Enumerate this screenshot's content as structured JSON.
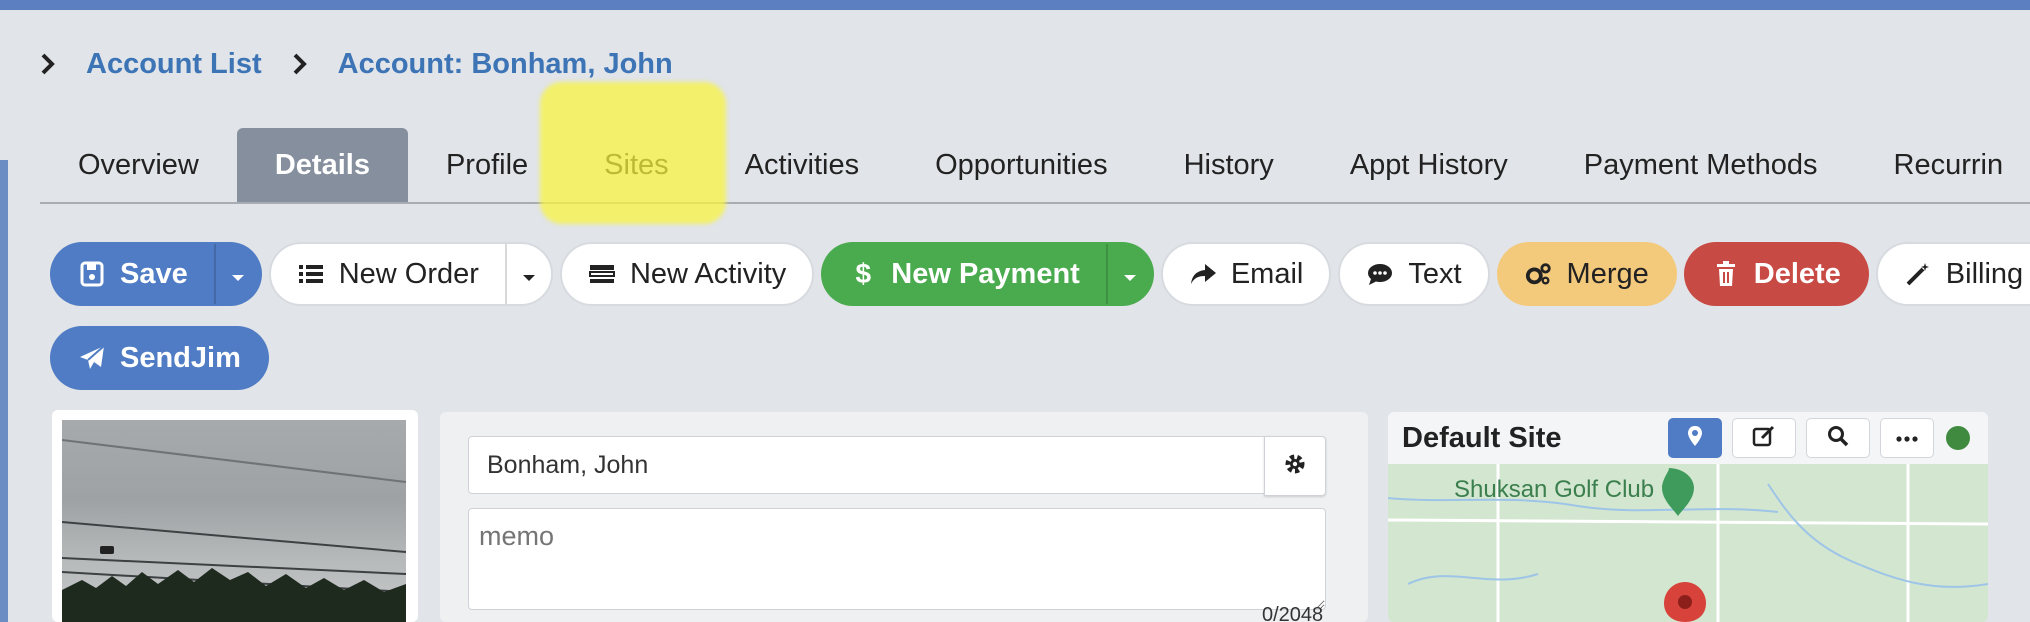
{
  "breadcrumb": {
    "items": [
      "Account List",
      "Account: Bonham, John"
    ]
  },
  "tabs": [
    {
      "label": "Overview",
      "active": false
    },
    {
      "label": "Details",
      "active": true
    },
    {
      "label": "Profile",
      "active": false
    },
    {
      "label": "Sites",
      "active": false
    },
    {
      "label": "Activities",
      "active": false
    },
    {
      "label": "Opportunities",
      "active": false
    },
    {
      "label": "History",
      "active": false
    },
    {
      "label": "Appt History",
      "active": false
    },
    {
      "label": "Payment Methods",
      "active": false
    },
    {
      "label": "Recurrin",
      "active": false
    }
  ],
  "toolbar": {
    "save": "Save",
    "new_order": "New Order",
    "new_activity": "New Activity",
    "new_payment": "New Payment",
    "email": "Email",
    "text": "Text",
    "merge": "Merge",
    "delete": "Delete",
    "billing": "Billing S",
    "sendjim": "SendJim"
  },
  "form": {
    "name_value": "Bonham, John",
    "memo_placeholder": "memo",
    "memo_counter": "0/2048"
  },
  "site": {
    "title": "Default Site",
    "map_label": "Shuksan Golf Club"
  },
  "colors": {
    "primary": "#4f7cc4",
    "success": "#4aab4e",
    "warning": "#f3c97c",
    "danger": "#c84a44",
    "active_tab": "#858f9d",
    "link": "#3c74b6"
  },
  "icons": [
    "chevron-right-icon",
    "save-icon",
    "caret-down-icon",
    "list-icon",
    "activity-icon",
    "dollar-icon",
    "share-icon",
    "comment-icon",
    "cogs-icon",
    "trash-icon",
    "magic-icon",
    "paper-plane-icon",
    "gear-icon",
    "map-pin-icon",
    "edit-icon",
    "search-icon",
    "ellipsis-icon"
  ]
}
